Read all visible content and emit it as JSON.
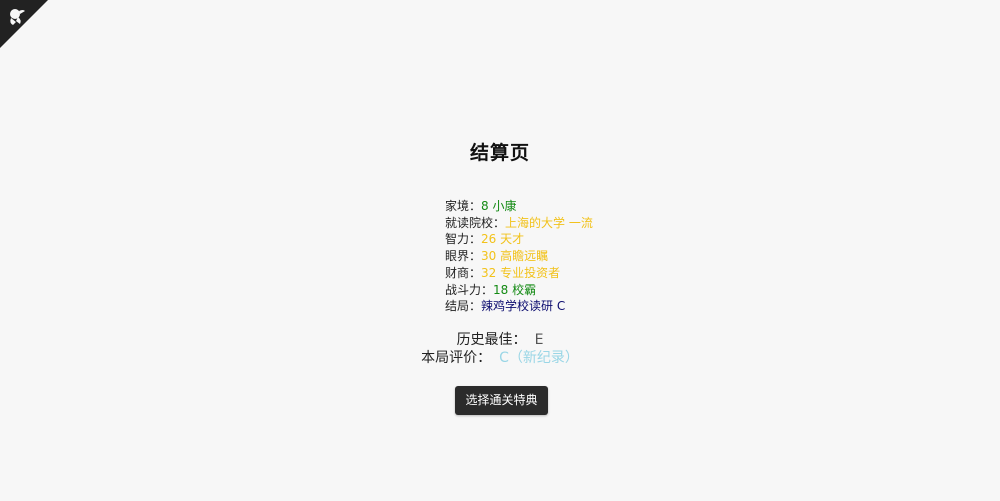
{
  "corner_icon": "github-octocat-corner-icon",
  "title": "结算页",
  "stats": [
    {
      "label": "家境：",
      "value": "8 小康",
      "color": "green"
    },
    {
      "label": "就读院校：",
      "value": "上海的大学 一流",
      "color": "gold"
    },
    {
      "label": "智力：",
      "value": "26 天才",
      "color": "gold"
    },
    {
      "label": "眼界：",
      "value": "30 高瞻远瞩",
      "color": "gold"
    },
    {
      "label": "财商：",
      "value": "32 专业投资者",
      "color": "gold"
    },
    {
      "label": "战斗力：",
      "value": "18 校霸",
      "color": "green"
    },
    {
      "label": "结局：",
      "value": "辣鸡学校读研 C",
      "color": "navy"
    }
  ],
  "summary": {
    "best_label": "历史最佳：",
    "best_value": "E",
    "current_label": "本局评价：",
    "current_value": "C（新纪录）"
  },
  "button_label": "选择通关特典",
  "colors": {
    "green": "#138a13",
    "gold": "#f2c21a",
    "navy": "#0a0a6e",
    "new_record": "#9ad6e6",
    "button_bg": "#2b2b2b"
  }
}
